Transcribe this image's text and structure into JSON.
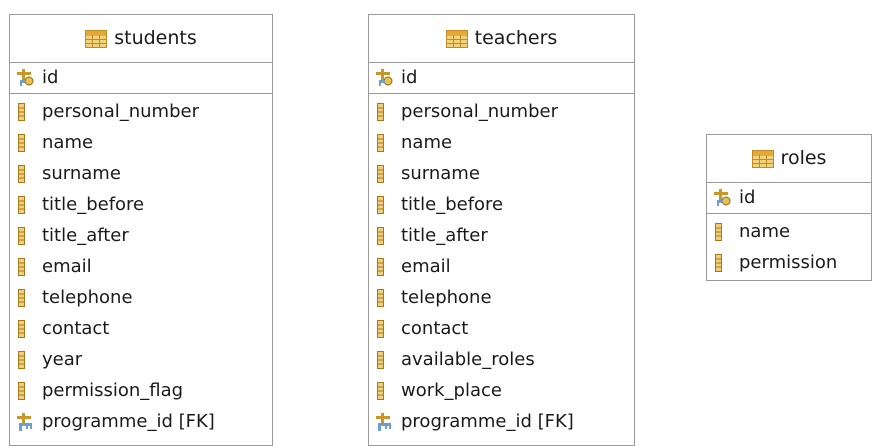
{
  "tables": [
    {
      "name": "students",
      "pk": "id",
      "columns": [
        {
          "name": "personal_number",
          "icon": "column-icon"
        },
        {
          "name": "name",
          "icon": "column-icon"
        },
        {
          "name": "surname",
          "icon": "column-icon"
        },
        {
          "name": "title_before",
          "icon": "column-icon"
        },
        {
          "name": "title_after",
          "icon": "column-icon"
        },
        {
          "name": "email",
          "icon": "column-icon"
        },
        {
          "name": "telephone",
          "icon": "column-icon"
        },
        {
          "name": "contact",
          "icon": "column-icon"
        },
        {
          "name": "year",
          "icon": "column-icon"
        },
        {
          "name": "permission_flag",
          "icon": "column-icon"
        },
        {
          "name": "programme_id [FK]",
          "icon": "foreign-key-icon"
        }
      ]
    },
    {
      "name": "teachers",
      "pk": "id",
      "columns": [
        {
          "name": "personal_number",
          "icon": "column-icon"
        },
        {
          "name": "name",
          "icon": "column-icon"
        },
        {
          "name": "surname",
          "icon": "column-icon"
        },
        {
          "name": "title_before",
          "icon": "column-icon"
        },
        {
          "name": "title_after",
          "icon": "column-icon"
        },
        {
          "name": "email",
          "icon": "column-icon"
        },
        {
          "name": "telephone",
          "icon": "column-icon"
        },
        {
          "name": "contact",
          "icon": "column-icon"
        },
        {
          "name": "available_roles",
          "icon": "column-icon"
        },
        {
          "name": "work_place",
          "icon": "column-icon"
        },
        {
          "name": "programme_id [FK]",
          "icon": "foreign-key-icon"
        }
      ]
    },
    {
      "name": "roles",
      "pk": "id",
      "columns": [
        {
          "name": "name",
          "icon": "column-icon"
        },
        {
          "name": "permission",
          "icon": "column-icon"
        }
      ]
    }
  ],
  "colors": {
    "border": "#9a9a9a",
    "table_icon_fill": "#f2d27a",
    "table_icon_grid": "#d29a2a",
    "column_icon": "#c8962a",
    "key_icon": "#6a9fd6"
  }
}
